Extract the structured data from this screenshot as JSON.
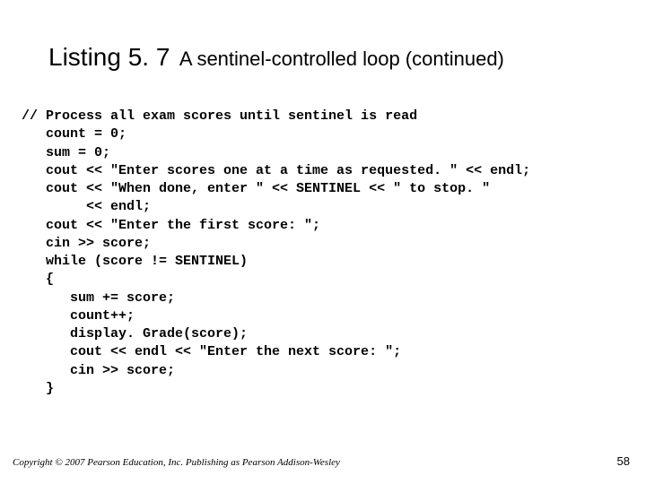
{
  "title": {
    "listing": "Listing 5. 7",
    "subtitle": "A sentinel-controlled loop (continued)"
  },
  "code": "// Process all exam scores until sentinel is read\n   count = 0;\n   sum = 0;\n   cout << \"Enter scores one at a time as requested. \" << endl;\n   cout << \"When done, enter \" << SENTINEL << \" to stop. \"\n        << endl;\n   cout << \"Enter the first score: \";\n   cin >> score;\n   while (score != SENTINEL)\n   {\n      sum += score;\n      count++;\n      display. Grade(score);\n      cout << endl << \"Enter the next score: \";\n      cin >> score;\n   }",
  "footer": "Copyright © 2007 Pearson Education, Inc. Publishing as Pearson Addison-Wesley",
  "page": "58"
}
